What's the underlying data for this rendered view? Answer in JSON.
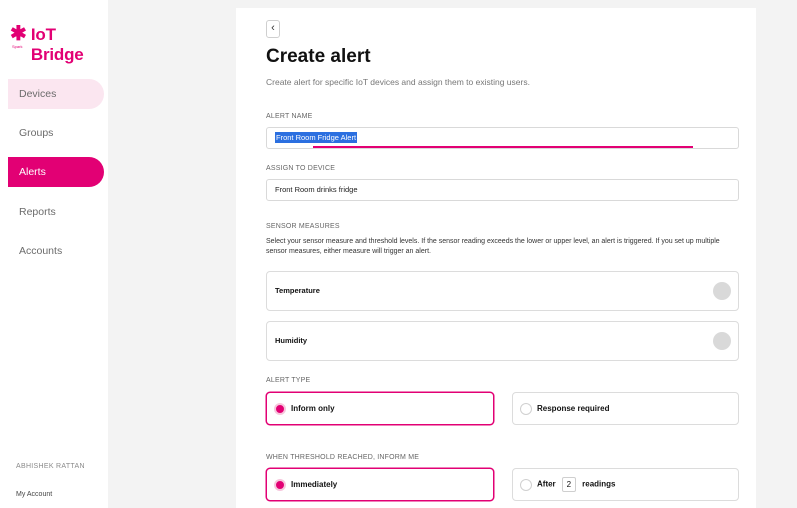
{
  "brand": {
    "name": "IoT Bridge",
    "sub": "Spark",
    "accent": "#e20074"
  },
  "sidebar": {
    "items": [
      {
        "label": "Devices"
      },
      {
        "label": "Groups"
      },
      {
        "label": "Alerts"
      },
      {
        "label": "Reports"
      },
      {
        "label": "Accounts"
      }
    ],
    "user_name": "ABHISHEK RATTAN",
    "my_account": "My Account"
  },
  "header": {
    "back": "‹",
    "title": "Create alert",
    "subtitle": "Create alert for specific IoT devices and assign them to existing users."
  },
  "form": {
    "alert_name_label": "ALERT NAME",
    "alert_name_value": "Front Room Fridge Alert",
    "assign_label": "ASSIGN TO DEVICE",
    "assign_value": "Front Room drinks fridge",
    "sensor_label": "SENSOR MEASURES",
    "sensor_desc": "Select your sensor measure and threshold levels. If the sensor reading exceeds the lower or upper level, an alert is triggered. If you set up multiple sensor measures, either measure will trigger an alert.",
    "sensors": [
      {
        "label": "Temperature",
        "enabled": false
      },
      {
        "label": "Humidity",
        "enabled": false
      }
    ],
    "alert_type_label": "ALERT TYPE",
    "alert_types": [
      {
        "label": "Inform only",
        "selected": true
      },
      {
        "label": "Response required",
        "selected": false
      }
    ],
    "threshold_label": "WHEN THRESHOLD REACHED, INFORM ME",
    "threshold_options": {
      "immediately": "Immediately",
      "after_prefix": "After",
      "after_count": "2",
      "after_suffix": "readings"
    }
  }
}
